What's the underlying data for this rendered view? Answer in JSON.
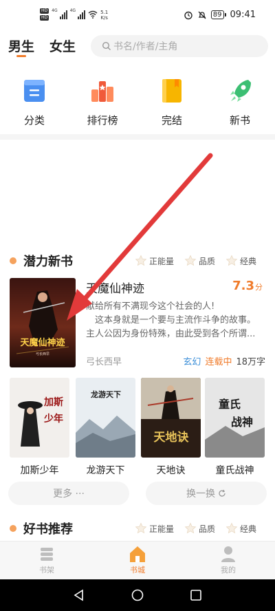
{
  "status_bar": {
    "hd1": "HD",
    "hd2": "HD",
    "sig1": "4G",
    "sig2": "4G",
    "net_speed_value": "5.1",
    "net_speed_unit": "K/s",
    "battery": "89",
    "time": "09:41"
  },
  "header": {
    "tabs": [
      {
        "label": "男生",
        "active": true
      },
      {
        "label": "女生",
        "active": false
      }
    ],
    "search_placeholder": "书名/作者/主角"
  },
  "categories": [
    {
      "label": "分类",
      "icon": "category-icon",
      "color": "#4a8ff0"
    },
    {
      "label": "排行榜",
      "icon": "ranking-icon",
      "color": "#f05a3a"
    },
    {
      "label": "完结",
      "icon": "finished-book-icon",
      "color": "#f7b500"
    },
    {
      "label": "新书",
      "icon": "rocket-icon",
      "color": "#3cbf73"
    }
  ],
  "section_potential": {
    "title": "潜力新书",
    "tags": [
      "正能量",
      "品质",
      "经典"
    ]
  },
  "featured_book": {
    "title": "天魔仙神迹",
    "score": "7.3",
    "score_unit": "分",
    "desc_lines": [
      "献给所有不满现今这个社会的人!",
      "　这本身就是一个要与主流作斗争的故事。",
      "主人公因为身份特殊，由此受到各个所谓..."
    ],
    "author": "弓长西早",
    "genre": "玄幻",
    "status": "连载中",
    "words": "18万字",
    "cover_title": "天魔仙神迹"
  },
  "grid_books": [
    {
      "title": "加斯少年",
      "cover_text": "加斯少年"
    },
    {
      "title": "龙游天下",
      "cover_text": "龙游天下"
    },
    {
      "title": "天地诀",
      "cover_text": "天地诀"
    },
    {
      "title": "童氏战神",
      "cover_text": "童氏战神"
    }
  ],
  "actions": {
    "more": "更多 ···",
    "refresh": "换一换"
  },
  "section_recommend": {
    "title": "好书推荐",
    "tags": [
      "正能量",
      "品质",
      "经典"
    ]
  },
  "bottom_nav": [
    {
      "label": "书架",
      "icon": "bookshelf-icon",
      "active": false
    },
    {
      "label": "书城",
      "icon": "bookstore-home-icon",
      "active": true
    },
    {
      "label": "我的",
      "icon": "profile-icon",
      "active": false
    }
  ],
  "colors": {
    "accent": "#f07b2a",
    "genre": "#3c8fd8",
    "annotation_arrow": "#e23a3a"
  }
}
